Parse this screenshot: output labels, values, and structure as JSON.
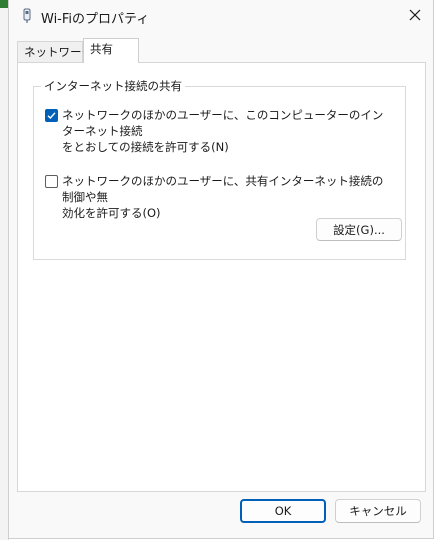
{
  "window": {
    "title": "Wi-Fiのプロパティ",
    "close_icon": "close-icon",
    "title_icon": "wifi-adapter-icon"
  },
  "tabs": [
    {
      "label": "ネットワーク",
      "selected": false
    },
    {
      "label": "共有",
      "selected": true
    }
  ],
  "sharing": {
    "group_title": "インターネット接続の共有",
    "option1": {
      "line1": "ネットワークのほかのユーザーに、このコンピューターのインターネット接続",
      "line2": "をとおしての接続を許可する(N)",
      "checked": true
    },
    "option2": {
      "line1": "ネットワークのほかのユーザーに、共有インターネット接続の制御や無",
      "line2": "効化を許可する(O)",
      "checked": false
    },
    "settings_label": "設定(G)..."
  },
  "footer": {
    "ok_label": "OK",
    "cancel_label": "キャンセル"
  },
  "colors": {
    "accent": "#005fb8",
    "dialog_bg": "#f9f9f9",
    "panel_bg": "#ffffff"
  }
}
